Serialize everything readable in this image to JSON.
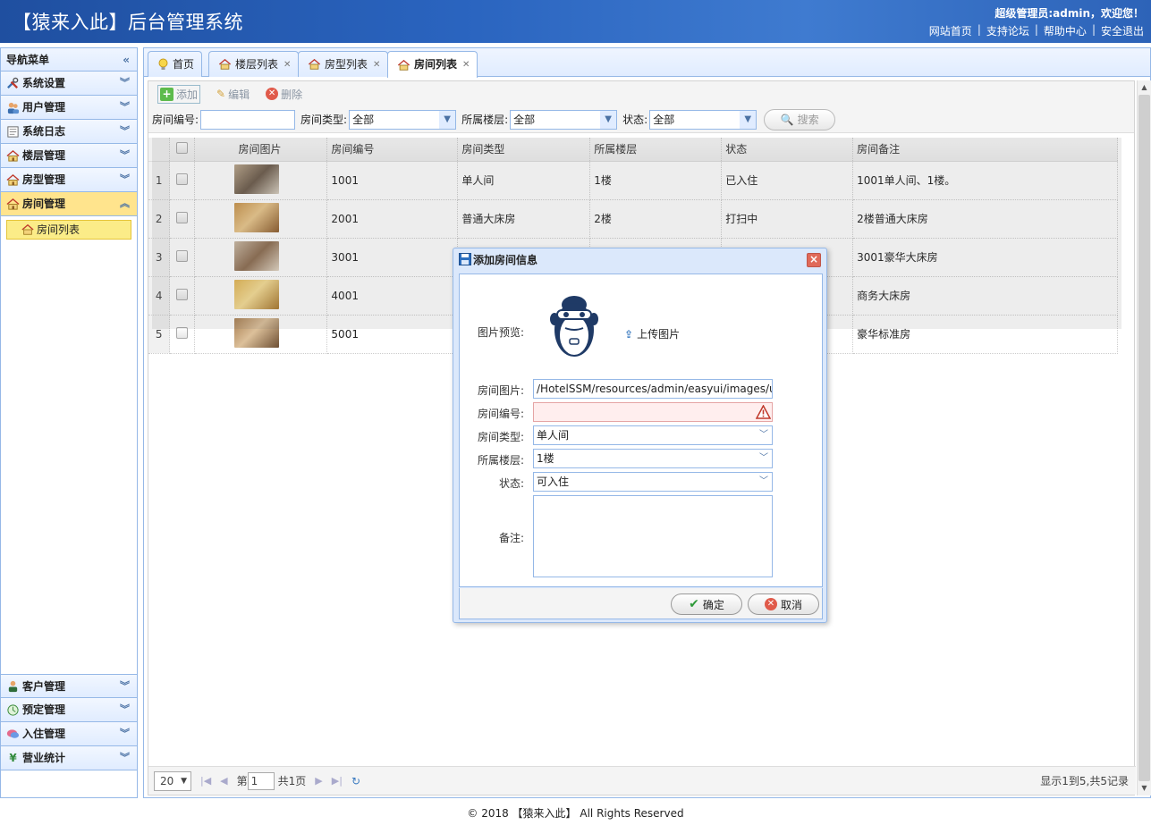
{
  "header": {
    "title": "【猿来入此】后台管理系统",
    "welcome": "超级管理员:admin，欢迎您！",
    "links": [
      "网站首页",
      "支持论坛",
      "帮助中心",
      "安全退出"
    ],
    "link_separator": "|"
  },
  "sidebar": {
    "title": "导航菜单",
    "collapse_glyph": "«",
    "items": [
      {
        "label": "系统设置",
        "icon": "tools-icon",
        "active": false
      },
      {
        "label": "用户管理",
        "icon": "users-icon",
        "active": false
      },
      {
        "label": "系统日志",
        "icon": "log-icon",
        "active": false
      },
      {
        "label": "楼层管理",
        "icon": "house-icon",
        "active": false
      },
      {
        "label": "房型管理",
        "icon": "house-icon",
        "active": false
      },
      {
        "label": "房间管理",
        "icon": "house-icon",
        "active": true
      }
    ],
    "active_sub": "房间列表",
    "bottom_items": [
      {
        "label": "客户管理",
        "icon": "customers-icon"
      },
      {
        "label": "预定管理",
        "icon": "clock-icon"
      },
      {
        "label": "入住管理",
        "icon": "speech-icon"
      },
      {
        "label": "营业统计",
        "icon": "yen-icon"
      }
    ]
  },
  "tabs": [
    {
      "label": "首页",
      "icon": "bulb-icon",
      "closable": false,
      "selected": false
    },
    {
      "label": "楼层列表",
      "icon": "house-icon",
      "closable": true,
      "selected": false
    },
    {
      "label": "房型列表",
      "icon": "house-icon",
      "closable": true,
      "selected": false
    },
    {
      "label": "房间列表",
      "icon": "house-icon",
      "closable": true,
      "selected": true
    }
  ],
  "toolbar": {
    "add": "添加",
    "edit": "编辑",
    "delete": "删除"
  },
  "filter": {
    "room_no_label": "房间编号:",
    "room_no_value": "",
    "room_type_label": "房间类型:",
    "room_type_value": "全部",
    "floor_label": "所属楼层:",
    "floor_value": "全部",
    "status_label": "状态:",
    "status_value": "全部",
    "search": "搜索"
  },
  "grid": {
    "columns": [
      "房间图片",
      "房间编号",
      "房间类型",
      "所属楼层",
      "状态",
      "房间备注"
    ],
    "rows": [
      {
        "num": "1",
        "room_no": "1001",
        "type": "单人间",
        "floor": "1楼",
        "status": "已入住",
        "remark": "1001单人间、1楼。"
      },
      {
        "num": "2",
        "room_no": "2001",
        "type": "普通大床房",
        "floor": "2楼",
        "status": "打扫中",
        "remark": "2楼普通大床房"
      },
      {
        "num": "3",
        "room_no": "3001",
        "type": "",
        "floor": "",
        "status": "",
        "remark": "3001豪华大床房"
      },
      {
        "num": "4",
        "room_no": "4001",
        "type": "",
        "floor": "",
        "status": "",
        "remark": "商务大床房"
      },
      {
        "num": "5",
        "room_no": "5001",
        "type": "",
        "floor": "",
        "status": "",
        "remark": "豪华标准房"
      }
    ]
  },
  "pager": {
    "page_size": "20",
    "page_prefix": "第",
    "page_value": "1",
    "page_total": "共1页",
    "info": "显示1到5,共5记录"
  },
  "dialog": {
    "title": "添加房间信息",
    "preview_label": "图片预览:",
    "upload": "上传图片",
    "photo_label": "房间图片:",
    "photo_value": "/HotelSSM/resources/admin/easyui/images/u",
    "room_no_label": "房间编号:",
    "room_no_value": "",
    "type_label": "房间类型:",
    "type_value": "单人间",
    "floor_label": "所属楼层:",
    "floor_value": "1楼",
    "status_label": "状态:",
    "status_value": "可入住",
    "remark_label": "备注:",
    "remark_value": "",
    "ok": "确定",
    "cancel": "取消"
  },
  "footer": "© 2018 【猿来入此】 All Rights Reserved",
  "colors": {
    "header": "#2a64bf",
    "border": "#95b8e7",
    "active_menu": "#ffe48d",
    "sub_item": "#fbec88"
  }
}
